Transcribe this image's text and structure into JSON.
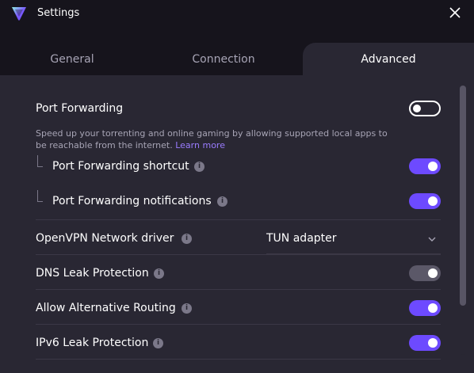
{
  "window": {
    "title": "Settings",
    "logo_icon": "proton-vpn-logo-icon",
    "close_icon": "close-icon"
  },
  "tabs": [
    {
      "label": "General",
      "active": false
    },
    {
      "label": "Connection",
      "active": false
    },
    {
      "label": "Advanced",
      "active": true
    }
  ],
  "settings": {
    "port_forwarding": {
      "label": "Port Forwarding",
      "enabled": false,
      "description": "Speed up your torrenting and online gaming by allowing supported local apps to be reachable from the internet.",
      "learn_more": "Learn more"
    },
    "port_forwarding_shortcut": {
      "label": "Port Forwarding shortcut",
      "enabled": true
    },
    "port_forwarding_notifications": {
      "label": "Port Forwarding notifications",
      "enabled": true
    },
    "openvpn_driver": {
      "label": "OpenVPN Network driver",
      "value": "TUN adapter"
    },
    "dns_leak": {
      "label": "DNS Leak Protection",
      "enabled": true,
      "disabled_state": true
    },
    "alt_routing": {
      "label": "Allow Alternative Routing",
      "enabled": true
    },
    "ipv6_leak": {
      "label": "IPv6 Leak Protection",
      "enabled": true
    }
  },
  "info_glyph": "i",
  "colors": {
    "accent": "#6d4aff",
    "link": "#9a7cff",
    "background": "#292733",
    "titlebar": "#16141c",
    "toggle_disabled": "#5b5868"
  }
}
